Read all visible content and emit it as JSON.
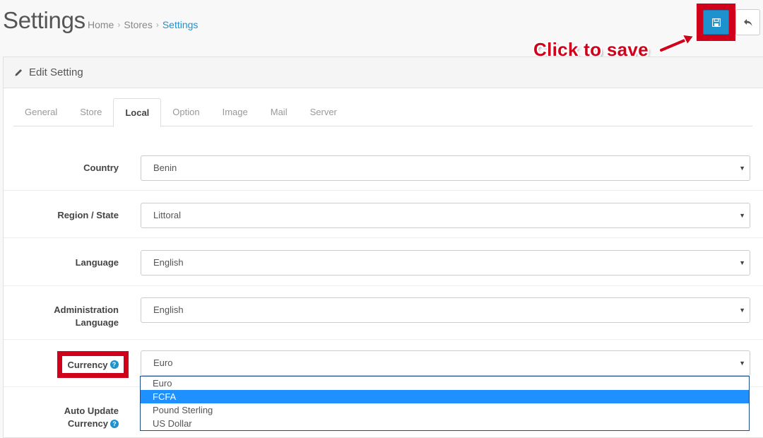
{
  "header": {
    "title": "Settings",
    "breadcrumb": [
      "Home",
      "Stores",
      "Settings"
    ],
    "breadcrumb_sep": "›"
  },
  "annotation": {
    "text": "Click to save"
  },
  "panel": {
    "heading": "Edit Setting",
    "tabs": [
      "General",
      "Store",
      "Local",
      "Option",
      "Image",
      "Mail",
      "Server"
    ],
    "active_tab": "Local"
  },
  "form": {
    "country": {
      "label": "Country",
      "value": "Benin"
    },
    "region": {
      "label": "Region / State",
      "value": "Littoral"
    },
    "language": {
      "label": "Language",
      "value": "English"
    },
    "admin_language": {
      "label_line1": "Administration",
      "label_line2": "Language",
      "value": "English"
    },
    "currency": {
      "label": "Currency",
      "value": "Euro",
      "help": "?"
    },
    "auto_update": {
      "label_line1": "Auto Update",
      "label_line2": "Currency",
      "help": "?"
    }
  },
  "currency_options": [
    "Euro",
    "FCFA",
    "Pound Sterling",
    "US Dollar"
  ],
  "currency_highlighted": "FCFA",
  "colors": {
    "primary": "#1e91cf",
    "annotation": "#d0021b",
    "option_highlight": "#1e90ff"
  },
  "icons": {
    "save": "floppy-disk-icon",
    "back": "reply-icon",
    "edit": "pencil-icon",
    "caret": "caret-down-icon"
  }
}
